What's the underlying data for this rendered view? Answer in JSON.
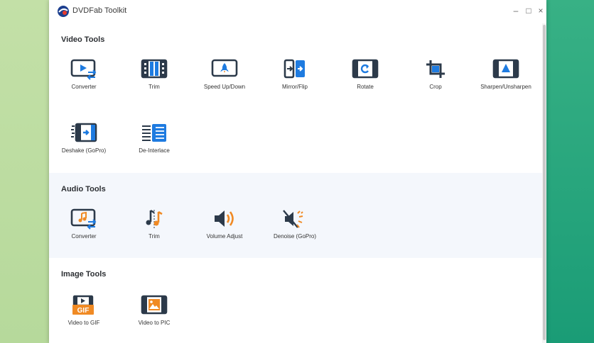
{
  "window": {
    "title": "DVDFab Toolkit",
    "controls": {
      "minimize": "–",
      "maximize": "□",
      "close": "×"
    }
  },
  "colors": {
    "accent_blue": "#1e7be0",
    "accent_orange": "#f08a24",
    "icon_dark": "#2c3a4a"
  },
  "sections": {
    "video": {
      "title": "Video Tools",
      "tools": [
        {
          "label": "Converter",
          "icon": "video-converter-icon"
        },
        {
          "label": "Trim",
          "icon": "film-trim-icon"
        },
        {
          "label": "Speed Up/Down",
          "icon": "rocket-speed-icon"
        },
        {
          "label": "Mirror/Flip",
          "icon": "mirror-flip-icon"
        },
        {
          "label": "Rotate",
          "icon": "rotate-icon"
        },
        {
          "label": "Crop",
          "icon": "crop-icon"
        },
        {
          "label": "Sharpen/Unsharpen",
          "icon": "sharpen-icon"
        },
        {
          "label": "Deshake (GoPro)",
          "icon": "deshake-icon"
        },
        {
          "label": "De-Interlace",
          "icon": "deinterlace-icon"
        }
      ]
    },
    "audio": {
      "title": "Audio Tools",
      "tools": [
        {
          "label": "Converter",
          "icon": "audio-converter-icon"
        },
        {
          "label": "Trim",
          "icon": "audio-trim-icon"
        },
        {
          "label": "Volume Adjust",
          "icon": "volume-icon"
        },
        {
          "label": "Denoise (GoPro)",
          "icon": "denoise-icon"
        }
      ]
    },
    "image": {
      "title": "Image Tools",
      "tools": [
        {
          "label": "Video to GIF",
          "icon": "video-to-gif-icon",
          "badge": "GIF"
        },
        {
          "label": "Video to PIC",
          "icon": "video-to-pic-icon"
        }
      ]
    }
  }
}
